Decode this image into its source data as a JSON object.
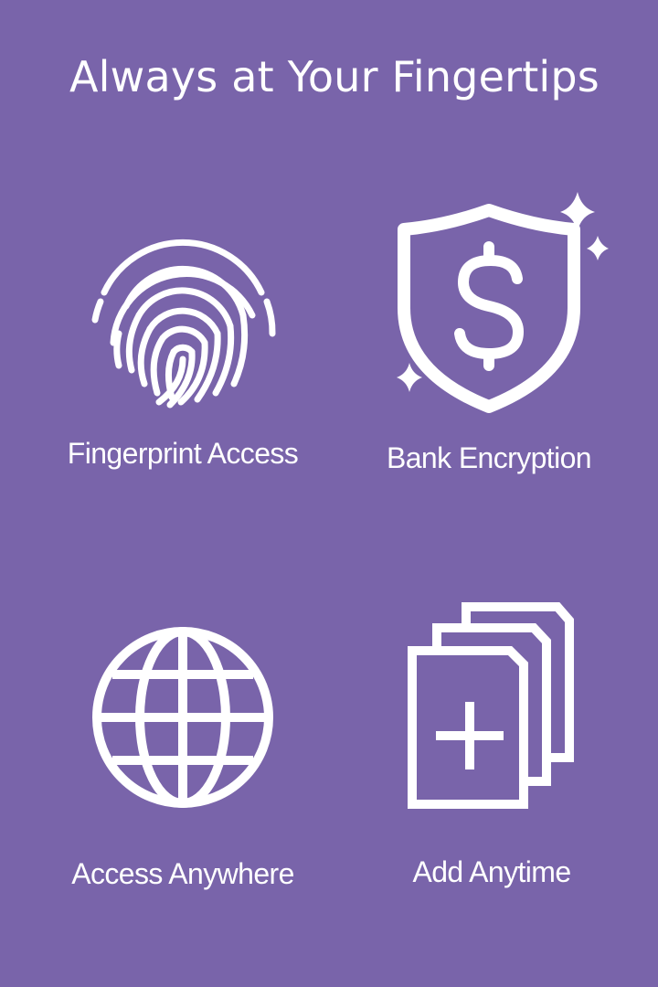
{
  "page": {
    "title": "Always at Your Fingertips",
    "background_color": "#7964AA",
    "foreground_color": "#FFFFFF"
  },
  "features": [
    {
      "label": "Fingerprint Access",
      "icon": "fingerprint-icon"
    },
    {
      "label": "Bank Encryption",
      "icon": "shield-dollar-icon"
    },
    {
      "label": "Access Anywhere",
      "icon": "globe-icon"
    },
    {
      "label": "Add Anytime",
      "icon": "add-documents-icon"
    }
  ]
}
